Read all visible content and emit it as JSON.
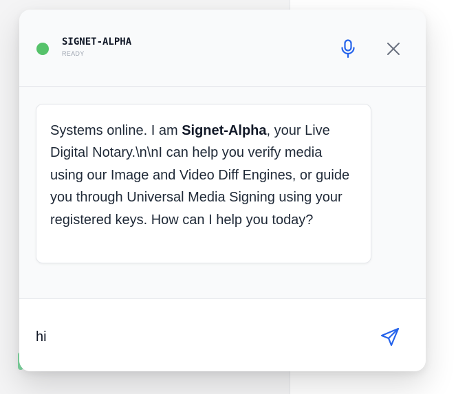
{
  "colors": {
    "status_dot": "#56c26a",
    "accent": "#2563eb",
    "muted_icon": "#6b7280"
  },
  "header": {
    "agent_name": "SIGNET-ALPHA",
    "status": "READY",
    "mic_icon": "microphone-icon",
    "close_icon": "close-icon"
  },
  "message": {
    "text_part1": "Systems online. I am ",
    "text_bold": "Signet-Alpha",
    "text_part2": ", your Live Digital Notary.\\n\\nI can help you verify media using our Image and Video Diff Engines, or guide you through Universal Media Signing using your registered keys. How can I help you today?"
  },
  "composer": {
    "input_value": "hi",
    "send_icon": "send-icon"
  }
}
